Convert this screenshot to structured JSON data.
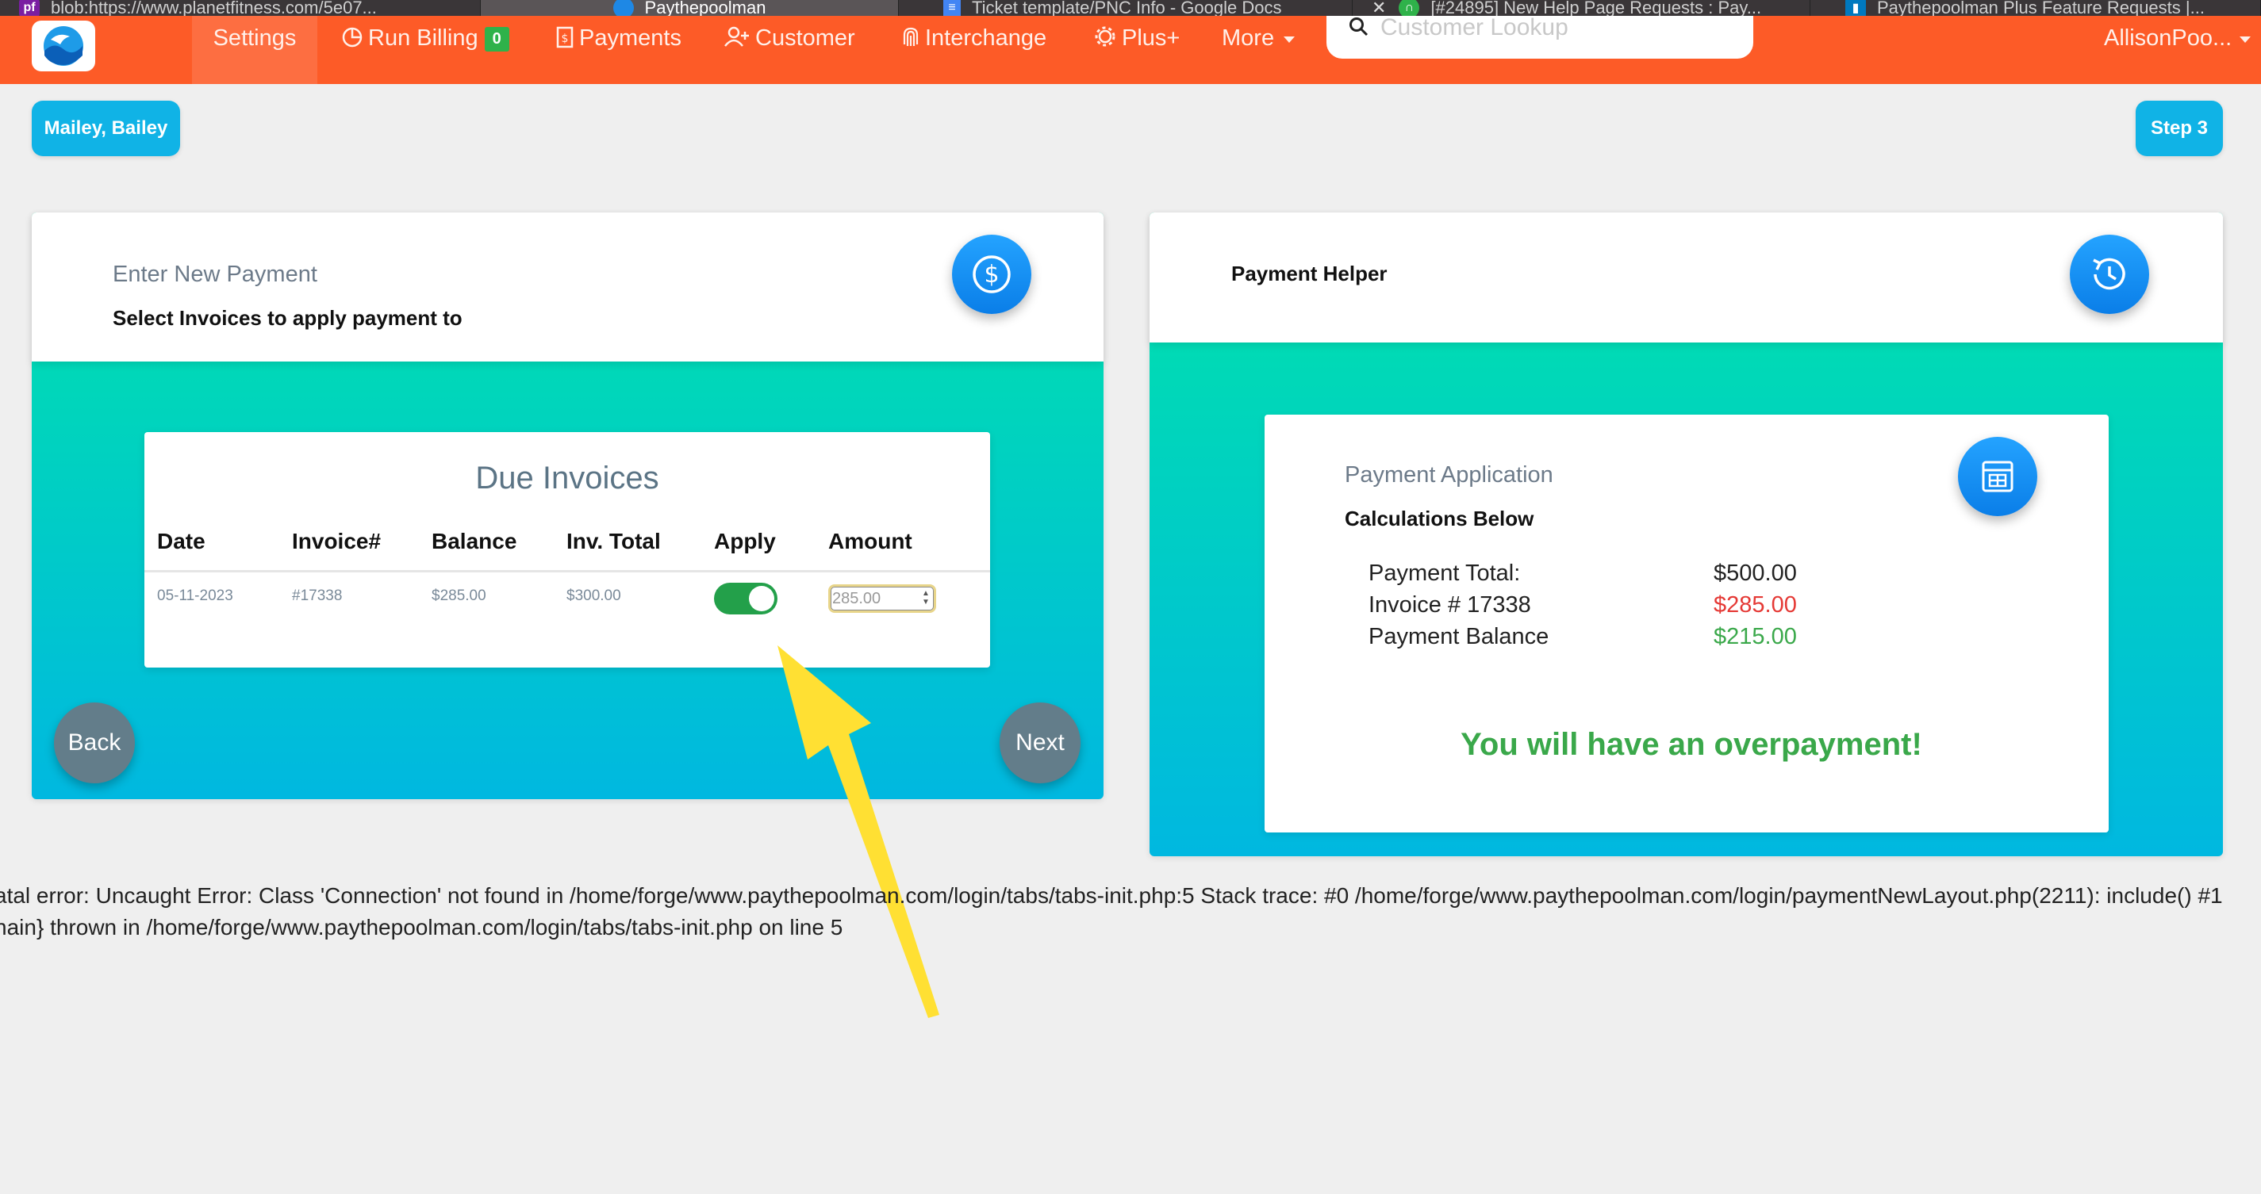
{
  "browser_tabs": [
    {
      "title": "blob:https://www.planetfitness.com/5e07...",
      "icon": "planetfitness-favicon",
      "color": "#7a1fa2"
    },
    {
      "title": "Paythepoolman",
      "icon": "paythepoolman-favicon",
      "color": "#1e88e5"
    },
    {
      "title": "Ticket template/PNC Info - Google Docs",
      "icon": "google-docs-icon",
      "color": "#4285f4"
    },
    {
      "title": "[#24895] New Help Page Requests : Pay...",
      "icon": "headset-icon",
      "color": "#2fb24a"
    },
    {
      "title": "Paythepoolman Plus Feature Requests |...",
      "icon": "trello-icon",
      "color": "#0079bf"
    }
  ],
  "nav": {
    "settings": "Settings",
    "run_billing": "Run Billing",
    "run_billing_badge": "0",
    "payments": "Payments",
    "customer": "Customer",
    "interchange": "Interchange",
    "plus": "Plus+",
    "more": "More",
    "search_placeholder": "Customer Lookup",
    "user": "AllisonPoo..."
  },
  "customer_pill": "Mailey, Bailey",
  "step_pill": "Step 3",
  "enter_payment": {
    "title": "Enter New Payment",
    "subtitle": "Select Invoices to apply payment to",
    "icon": "dollar-icon"
  },
  "due_invoices": {
    "title": "Due Invoices",
    "columns": [
      "Date",
      "Invoice#",
      "Balance",
      "Inv. Total",
      "Apply",
      "Amount"
    ],
    "rows": [
      {
        "date": "05-11-2023",
        "invoice": "#17338",
        "balance": "$285.00",
        "total": "$300.00",
        "apply": true,
        "amount": "285.00"
      }
    ]
  },
  "buttons": {
    "back": "Back",
    "next": "Next"
  },
  "payment_helper": {
    "title": "Payment Helper",
    "icon": "history-icon"
  },
  "payment_application": {
    "title": "Payment Application",
    "subtitle": "Calculations Below",
    "icon": "calculator-icon",
    "lines": [
      {
        "label": "Payment Total:",
        "value": "$500.00",
        "color": "#222222"
      },
      {
        "label": "Invoice # 17338",
        "value": "$285.00",
        "color": "#e53935"
      },
      {
        "label": "Payment Balance",
        "value": "$215.00",
        "color": "#3aa84a"
      }
    ],
    "message": "You will have an overpayment!"
  },
  "error": {
    "line1": "atal error: Uncaught Error: Class 'Connection' not found in /home/forge/www.paythepoolman.com/login/tabs/tabs-init.php:5 Stack trace: #0 /home/forge/www.paythepoolman.com/login/paymentNewLayout.php(2211): include() #1",
    "line2": "nain} thrown in /home/forge/www.paythepoolman.com/login/tabs/tabs-init.php on line 5"
  }
}
